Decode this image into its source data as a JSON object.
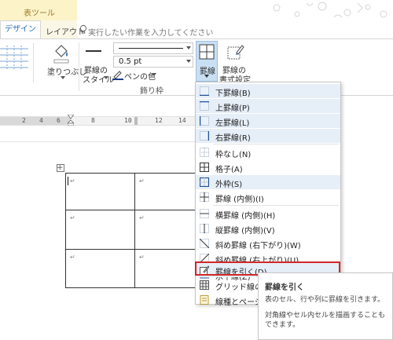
{
  "ribbon": {
    "context_tab": "表ツール",
    "tabs": {
      "design": "デザイン",
      "layout": "レイアウト"
    },
    "tell_me": "実行したい作業を入力してください",
    "shading": "塗りつぶし",
    "border_style_line1": "罫線の",
    "border_style_line2": "スタイル",
    "line_weight": "0.5 pt",
    "pen_color": "ペンの色",
    "borders_button": "罫線",
    "border_painter_line1": "罫線の",
    "border_painter_line2": "書式設定",
    "group_label": "飾り枠"
  },
  "ruler": [
    "2",
    "4",
    "6",
    "8",
    "10",
    "12",
    "14"
  ],
  "menu": {
    "items": [
      {
        "label": "下罫線(B)",
        "icon": "bottom-border-icon"
      },
      {
        "label": "上罫線(P)",
        "icon": "top-border-icon"
      },
      {
        "label": "左罫線(L)",
        "icon": "left-border-icon"
      },
      {
        "label": "右罫線(R)",
        "icon": "right-border-icon"
      },
      {
        "label": "枠なし(N)",
        "icon": "no-border-icon"
      },
      {
        "label": "格子(A)",
        "icon": "all-borders-icon"
      },
      {
        "label": "外枠(S)",
        "icon": "outside-borders-icon"
      },
      {
        "label": "罫線 (内側)(I)",
        "icon": "inside-borders-icon"
      },
      {
        "label": "横罫線 (内側)(H)",
        "icon": "inside-horizontal-border-icon"
      },
      {
        "label": "縦罫線 (内側)(V)",
        "icon": "inside-vertical-border-icon"
      },
      {
        "label": "斜め罫線 (右下がり)(W)",
        "icon": "diagonal-down-border-icon"
      },
      {
        "label": "斜め罫線 (右上がり)(U)",
        "icon": "diagonal-up-border-icon"
      },
      {
        "label": "水平線(Z)",
        "icon": "horizontal-line-icon"
      },
      {
        "label": "罫線を引く(D)",
        "icon": "draw-table-icon"
      },
      {
        "label": "グリッド線の表示(G)",
        "icon": "view-gridlines-icon"
      },
      {
        "label": "線種とページ罫線と網かけ",
        "icon": "borders-shading-icon"
      }
    ]
  },
  "tooltip": {
    "title": "罫線を引く",
    "line1": "表のセル、行や列に罫線を引きます。",
    "line2": "対角線やセル内セルを描画することもできます。"
  },
  "table": {
    "cell_mark": "↵"
  },
  "colors": {
    "accent": "#2f6fb5",
    "highlight": "#d22727",
    "context_tab": "#fcf3c9"
  }
}
